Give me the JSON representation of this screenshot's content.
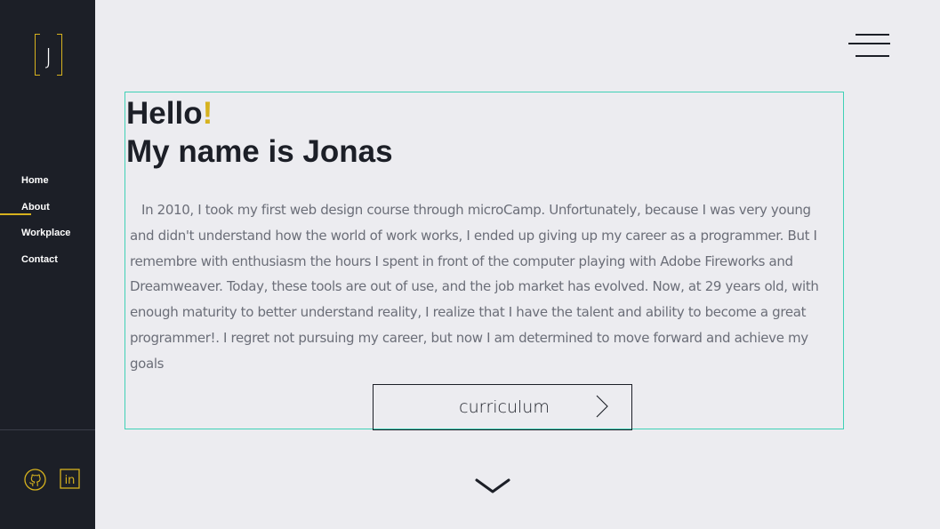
{
  "logo": {
    "letter": "J"
  },
  "nav": {
    "items": [
      {
        "label": "Home"
      },
      {
        "label": "About"
      },
      {
        "label": "Workplace"
      },
      {
        "label": "Contact"
      }
    ],
    "active": "About"
  },
  "social": [
    {
      "icon": "github-icon"
    },
    {
      "icon": "linkedin-icon",
      "text": "in"
    }
  ],
  "hero": {
    "greeting": "Hello",
    "greeting_mark": "!",
    "name_line": "My name is Jonas",
    "bio": "In 2010, I took my first web design course through microCamp. Unfortunately, because I was very young and didn't understand how the world of work works, I ended up giving up my career as a programmer. But I remembre with enthusiasm the hours I spent in front of the computer playing with Adobe Fireworks and Dreamweaver. Today, these tools are out of use, and the job market has evolved. Now, at 29 years old, with enough maturity to better understand reality, I realize that I have the talent and ability to become a great programmer!. I regret not pursuing my career, but now I am determined to move forward and achieve my goals",
    "button_label": "curriculum"
  },
  "colors": {
    "sidebar": "#1c1f27",
    "accent": "#d6b21e",
    "outline": "#3fd1b6",
    "background": "#ececf0"
  }
}
